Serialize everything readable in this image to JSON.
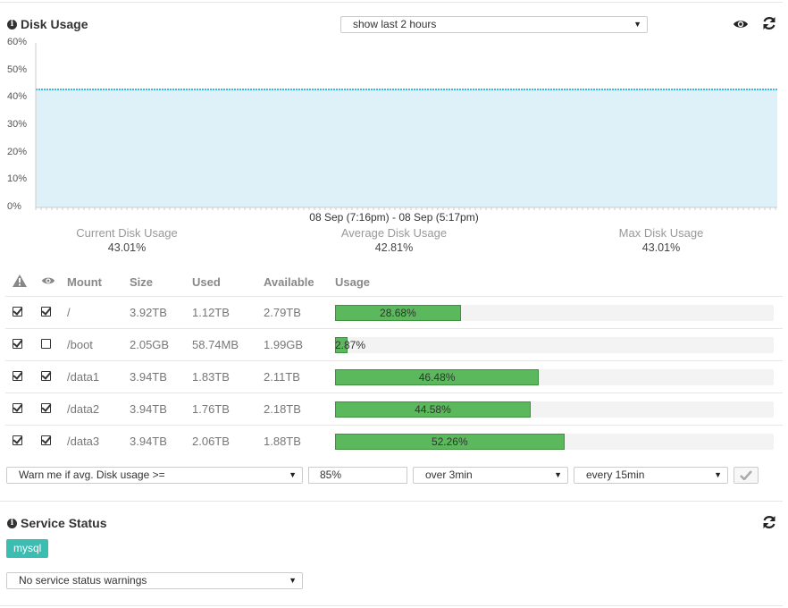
{
  "disk": {
    "title": "Disk Usage",
    "range_select": "show last 2 hours",
    "chart_data": {
      "type": "area",
      "x_range_label": "08 Sep (7:16pm) - 08 Sep (5:17pm)",
      "ytick_labels": [
        "60%",
        "50%",
        "40%",
        "30%",
        "20%",
        "10%",
        "0%"
      ],
      "ylim": [
        0,
        60
      ],
      "series": [
        {
          "values": [
            43.01,
            43.01,
            43.0,
            43.01,
            42.99,
            43.01,
            43.0,
            43.01
          ]
        }
      ],
      "grid": false
    },
    "stats": [
      {
        "label": "Current Disk Usage",
        "value": "43.01%"
      },
      {
        "label": "Average Disk Usage",
        "value": "42.81%"
      },
      {
        "label": "Max Disk Usage",
        "value": "43.01%"
      }
    ],
    "table": {
      "headers": {
        "mount": "Mount",
        "size": "Size",
        "used": "Used",
        "available": "Available",
        "usage": "Usage"
      },
      "rows": [
        {
          "alert": true,
          "watch": true,
          "mount": "/",
          "size": "3.92TB",
          "used": "1.12TB",
          "available": "2.79TB",
          "usage_label": "28.68%",
          "usage": 28.68
        },
        {
          "alert": true,
          "watch": false,
          "mount": "/boot",
          "size": "2.05GB",
          "used": "58.74MB",
          "available": "1.99GB",
          "usage_label": "2.87%",
          "usage": 2.87
        },
        {
          "alert": true,
          "watch": true,
          "mount": "/data1",
          "size": "3.94TB",
          "used": "1.83TB",
          "available": "2.11TB",
          "usage_label": "46.48%",
          "usage": 46.48
        },
        {
          "alert": true,
          "watch": true,
          "mount": "/data2",
          "size": "3.94TB",
          "used": "1.76TB",
          "available": "2.18TB",
          "usage_label": "44.58%",
          "usage": 44.58
        },
        {
          "alert": true,
          "watch": true,
          "mount": "/data3",
          "size": "3.94TB",
          "used": "2.06TB",
          "available": "1.88TB",
          "usage_label": "52.26%",
          "usage": 52.26
        }
      ]
    },
    "alert_rule": {
      "condition": "Warn me if avg. Disk usage >=",
      "threshold": "85%",
      "duration": "over 3min",
      "frequency": "every 15min"
    }
  },
  "service": {
    "title": "Service Status",
    "tag": "mysql",
    "warnings_select": "No service status warnings"
  },
  "icons": {
    "info": "info-circle-icon",
    "watch": "eye-icon",
    "refresh": "refresh-icon",
    "alert": "warning-triangle-icon",
    "confirm": "checkmark-icon"
  },
  "colors": {
    "area_fill": "#dff1f8",
    "area_line": "#39b6d6",
    "bar_fill": "#5cb85c",
    "tag": "#3bbdb1"
  }
}
